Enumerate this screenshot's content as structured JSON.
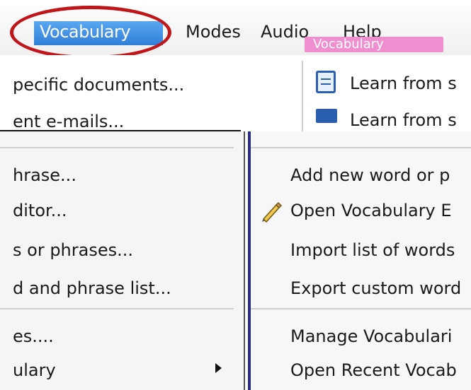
{
  "menubar": {
    "vocabulary": "Vocabulary",
    "modes": "Modes",
    "audio": "Audio",
    "help": "Help",
    "badge": "Vocabulary"
  },
  "top_menu": {
    "specific_documents": "pecific documents...",
    "emails": "ent e-mails...",
    "learn_docs": "Learn from s",
    "learn_emails": "Learn from s"
  },
  "left_menu": {
    "items": [
      "hrase...",
      "ditor...",
      "s or phrases...",
      "d and phrase list...",
      "es....",
      "ulary"
    ]
  },
  "right_menu": {
    "items": [
      "Add new word or p",
      "Open Vocabulary E",
      "Import list of words",
      "Export custom word",
      "Manage Vocabulari",
      "Open Recent Vocab"
    ]
  },
  "colors": {
    "highlight": "#2f7fd8",
    "annotation_oval": "#c0161a",
    "badge": "#f08fd0"
  },
  "icons": [
    "document-icon",
    "email-icon",
    "pencil-icon",
    "submenu-arrow-icon"
  ]
}
